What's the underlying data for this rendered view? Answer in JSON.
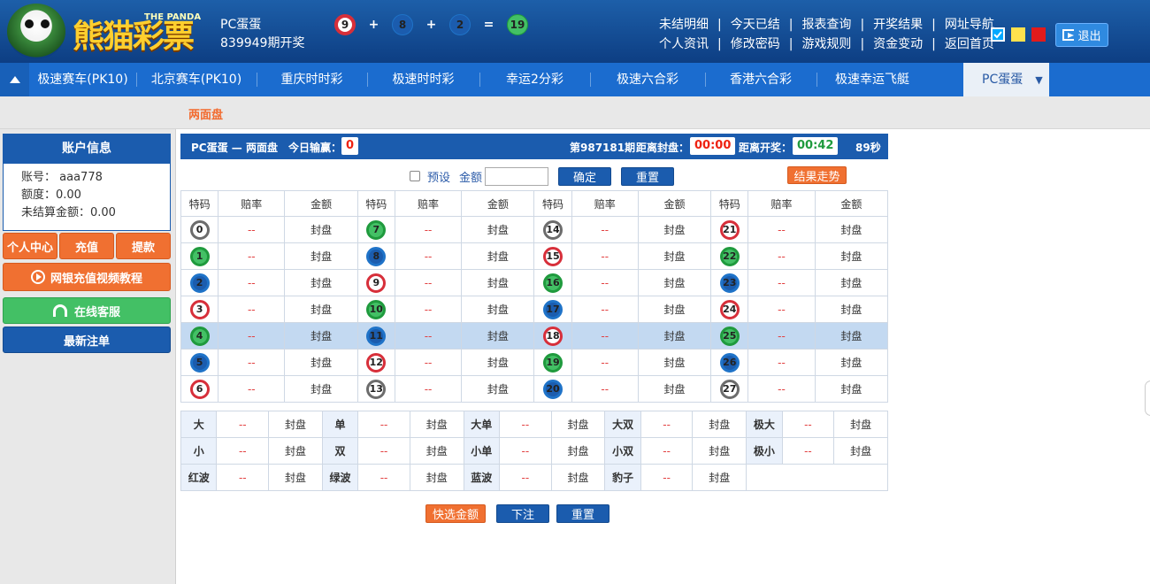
{
  "header": {
    "brand": "熊猫彩票",
    "brand_en": "THE PANDA",
    "game": "PC蛋蛋",
    "issue_text": "839949期开奖",
    "result": [
      {
        "n": "9",
        "c": "red"
      },
      {
        "op": "+"
      },
      {
        "n": "8",
        "c": "blue"
      },
      {
        "op": "+"
      },
      {
        "n": "2",
        "c": "blue"
      },
      {
        "op": "="
      },
      {
        "n": "19",
        "c": "green"
      }
    ],
    "links_row1": [
      "未结明细",
      "今天已结",
      "报表查询",
      "开奖结果",
      "网址导航"
    ],
    "links_row2": [
      "个人资讯",
      "修改密码",
      "游戏规则",
      "资金变动",
      "返回首页"
    ],
    "skin_colors": [
      "#00a8ff",
      "#ffe14d",
      "#e21b1b"
    ],
    "logout": "退出"
  },
  "nav": {
    "items": [
      "极速赛车(PK10)",
      "北京赛车(PK10)",
      "重庆时时彩",
      "极速时时彩",
      "幸运2分彩",
      "极速六合彩",
      "香港六合彩",
      "极速幸运飞艇"
    ],
    "active": "PC蛋蛋"
  },
  "subnav": {
    "label": "两面盘"
  },
  "sidebar": {
    "title": "账户信息",
    "account_label": "账号：",
    "account": "aaa778",
    "limit": "额度：0.00",
    "unsettled": "未结算金额：0.00",
    "btn_center": "个人中心",
    "btn_recharge": "充值",
    "btn_withdraw": "提款",
    "btn_video": "网银充值视频教程",
    "btn_service": "在线客服",
    "btn_latest": "最新注单"
  },
  "game_bar": {
    "title": "PC蛋蛋 — 两面盘",
    "today_label": "今日输赢：",
    "today_value": "0",
    "period": "第987181期",
    "close_label": "距离封盘：",
    "close_time": "00:00",
    "open_label": "距离开奖：",
    "open_time": "00:42",
    "seconds": "89秒"
  },
  "toolbar": {
    "preset": "预设",
    "amount_label": "金额",
    "amount_value": "",
    "confirm": "确定",
    "reset": "重置",
    "trend": "结果走势"
  },
  "table_headers": [
    "特码",
    "赔率",
    "金额"
  ],
  "odds_placeholder": "--",
  "closed_text": "封盘",
  "numbers": [
    [
      {
        "n": "0",
        "c": "gray"
      },
      {
        "n": "7",
        "c": "green"
      },
      {
        "n": "14",
        "c": "gray"
      },
      {
        "n": "21",
        "c": "red"
      }
    ],
    [
      {
        "n": "1",
        "c": "green"
      },
      {
        "n": "8",
        "c": "blue"
      },
      {
        "n": "15",
        "c": "red"
      },
      {
        "n": "22",
        "c": "green"
      }
    ],
    [
      {
        "n": "2",
        "c": "blue"
      },
      {
        "n": "9",
        "c": "red"
      },
      {
        "n": "16",
        "c": "green"
      },
      {
        "n": "23",
        "c": "blue"
      }
    ],
    [
      {
        "n": "3",
        "c": "red"
      },
      {
        "n": "10",
        "c": "green"
      },
      {
        "n": "17",
        "c": "blue"
      },
      {
        "n": "24",
        "c": "red"
      }
    ],
    [
      {
        "n": "4",
        "c": "green"
      },
      {
        "n": "11",
        "c": "blue"
      },
      {
        "n": "18",
        "c": "red"
      },
      {
        "n": "25",
        "c": "green"
      }
    ],
    [
      {
        "n": "5",
        "c": "blue"
      },
      {
        "n": "12",
        "c": "red"
      },
      {
        "n": "19",
        "c": "green"
      },
      {
        "n": "26",
        "c": "blue"
      }
    ],
    [
      {
        "n": "6",
        "c": "red"
      },
      {
        "n": "13",
        "c": "gray"
      },
      {
        "n": "20",
        "c": "blue"
      },
      {
        "n": "27",
        "c": "gray"
      }
    ]
  ],
  "highlight_row": 4,
  "combos": [
    [
      "大",
      "单",
      "大单",
      "大双",
      "极大"
    ],
    [
      "小",
      "双",
      "小单",
      "小双",
      "极小"
    ],
    [
      "红波",
      "绿波",
      "蓝波",
      "豹子"
    ]
  ],
  "bottom": {
    "quick": "快选金额",
    "submit": "下注",
    "reset": "重置"
  }
}
